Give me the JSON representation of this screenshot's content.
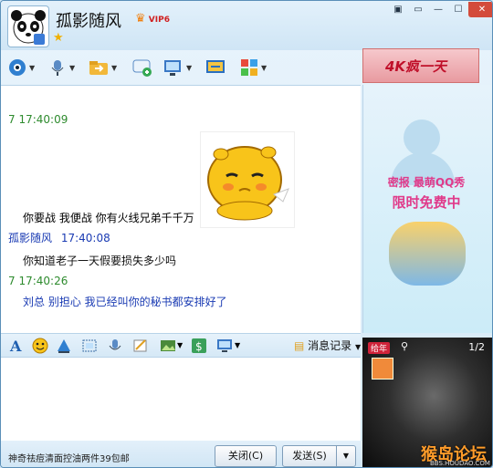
{
  "window": {
    "title": "孤影随风",
    "vip_label": "VIP6",
    "controls": [
      "▣",
      "▭",
      "—",
      "☐",
      "✕"
    ]
  },
  "toolbar": {
    "icons": [
      "camera-icon",
      "microphone-icon",
      "file-transfer-icon",
      "sms-icon",
      "remote-assist-icon",
      "share-screen-icon",
      "apps-icon"
    ]
  },
  "ads": {
    "top_banner": "4K疯一天",
    "side_promo_line1": "密报 最萌QQ秀",
    "side_promo_line2": "限时免费中"
  },
  "chat": {
    "messages": [
      {
        "sender": "",
        "time": "7  17:40:09",
        "text": "你要战  我便战  你有火线兄弟千千万",
        "color": "#2e8b2e",
        "text_color": "#1a3bb3"
      },
      {
        "sender": "孤影随风",
        "time": "17:40:08",
        "text": "你知道老子一天假要损失多少吗",
        "color": "#1a3bb3",
        "text_color": "#111111"
      },
      {
        "sender": "",
        "time": "7  17:40:26",
        "text": "刘总  别担心  我已经叫你的秘书都安排好了",
        "color": "#2e8b2e",
        "text_color": "#1a3bb3"
      }
    ]
  },
  "format_bar": {
    "icons": [
      "font-icon",
      "emoji-icon",
      "shake-icon",
      "screenshot-icon",
      "voice-message-icon",
      "scribble-icon",
      "image-icon",
      "music-icon",
      "screen-share-icon"
    ],
    "history_label": "消息记录"
  },
  "bottom": {
    "ad_text": "神奇祛痘清面控油两件39包邮",
    "close_label": "关闭(C)",
    "send_label": "发送(S)"
  },
  "photo": {
    "counter": "1/2",
    "badge": "给年"
  },
  "watermark": {
    "text": "猴岛论坛",
    "url": "BBS.HOUDAO.COM"
  }
}
